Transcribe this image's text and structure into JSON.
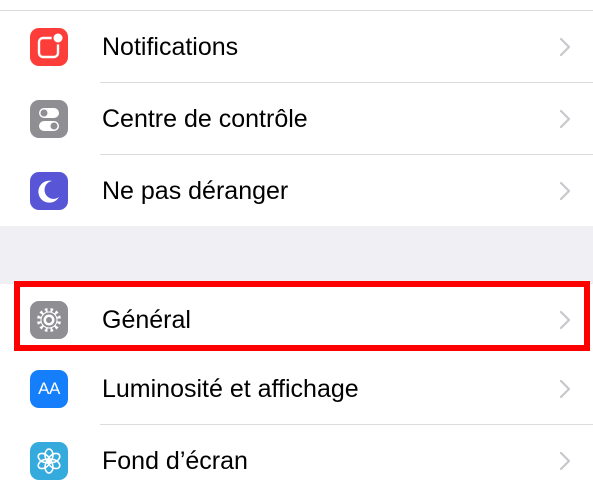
{
  "settings": {
    "group1": [
      {
        "label": "Notifications",
        "icon": "notifications-icon",
        "color": "#fc3d39"
      },
      {
        "label": "Centre de contrôle",
        "icon": "control-center-icon",
        "color": "#8e8e93"
      },
      {
        "label": "Ne pas déranger",
        "icon": "moon-icon",
        "color": "#5856d6"
      }
    ],
    "group2": [
      {
        "label": "Général",
        "icon": "gear-icon",
        "color": "#8e8e93"
      },
      {
        "label": "Luminosité et affichage",
        "icon": "display-brightness-icon",
        "color": "#147efb",
        "icon_text": "AA"
      },
      {
        "label": "Fond d’écran",
        "icon": "wallpaper-flower-icon",
        "color": "#35aadc"
      }
    ]
  },
  "highlight": {
    "target": "Général",
    "color": "#ff0000"
  }
}
